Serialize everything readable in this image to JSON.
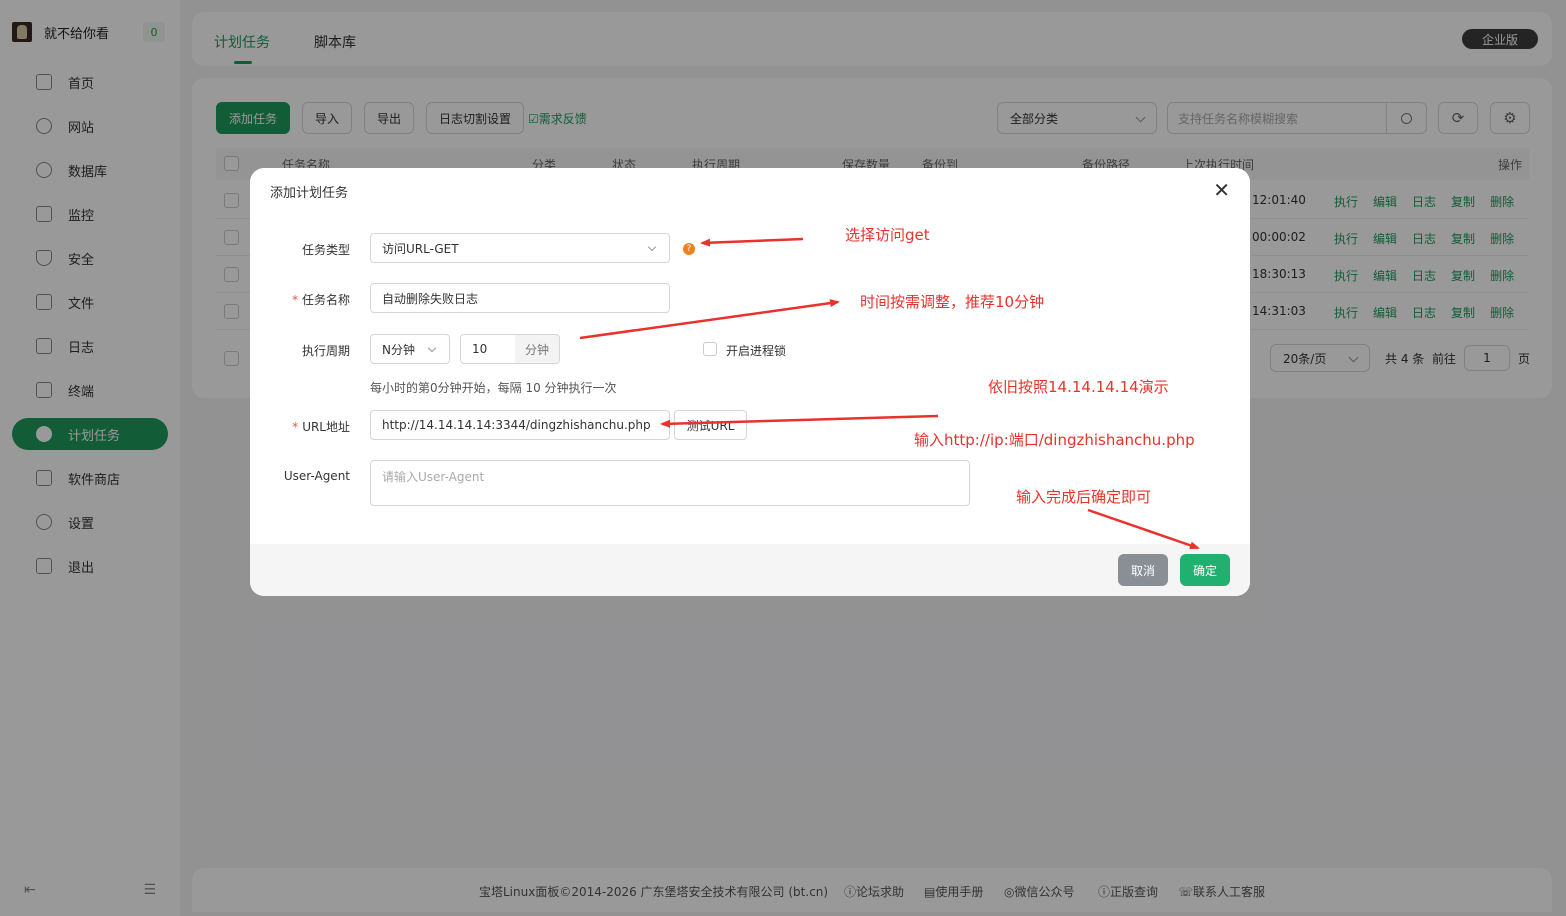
{
  "sidebar": {
    "username": "就不给你看",
    "badge": "0",
    "items": [
      {
        "label": "首页",
        "icon": "home-icon"
      },
      {
        "label": "网站",
        "icon": "globe-icon"
      },
      {
        "label": "数据库",
        "icon": "database-icon"
      },
      {
        "label": "监控",
        "icon": "monitor-icon"
      },
      {
        "label": "安全",
        "icon": "shield-icon"
      },
      {
        "label": "文件",
        "icon": "folder-icon"
      },
      {
        "label": "日志",
        "icon": "log-icon"
      },
      {
        "label": "终端",
        "icon": "terminal-icon"
      },
      {
        "label": "计划任务",
        "icon": "clock-icon"
      },
      {
        "label": "软件商店",
        "icon": "store-icon"
      },
      {
        "label": "设置",
        "icon": "gear-icon"
      },
      {
        "label": "退出",
        "icon": "logout-icon"
      }
    ],
    "active_index": 8
  },
  "tabs": {
    "cron": "计划任务",
    "scripts": "脚本库"
  },
  "edition": "企业版",
  "toolbar": {
    "add": "添加任务",
    "import": "导入",
    "export": "导出",
    "log_split": "日志切割设置",
    "feedback": "需求反馈",
    "category": "全部分类",
    "search_placeholder": "支持任务名称模糊搜索"
  },
  "table": {
    "headers": {
      "name": "任务名称",
      "category": "分类",
      "status": "状态",
      "period": "执行周期",
      "save_count": "保存数量",
      "backup_to": "备份到",
      "backup_path": "备份路径",
      "last_run": "上次执行时间",
      "ops": "操作"
    },
    "rows": [
      {
        "time": "12:01:40"
      },
      {
        "time": "00:00:02"
      },
      {
        "time": "18:30:13"
      },
      {
        "time": "14:31:03"
      }
    ],
    "ops": {
      "run": "执行",
      "edit": "编辑",
      "log": "日志",
      "copy": "复制",
      "del": "删除"
    }
  },
  "pager": {
    "per_page": "20条/页",
    "total": "共 4 条",
    "goto": "前往",
    "page": "1",
    "page_suffix": "页"
  },
  "dialog": {
    "title": "添加计划任务",
    "task_type_label": "任务类型",
    "task_type_value": "访问URL-GET",
    "task_name_label": "任务名称",
    "task_name_value": "自动删除失败日志",
    "period_label": "执行周期",
    "period_unit_select": "N分钟",
    "period_value": "10",
    "period_unit": "分钟",
    "lock_label": "开启进程锁",
    "hint": "每小时的第0分钟开始，每隔 10 分钟执行一次",
    "url_label": "URL地址",
    "url_value": "http://14.14.14.14:3344/dingzhishanchu.php",
    "test_url": "测试URL",
    "ua_label": "User-Agent",
    "ua_placeholder": "请输入User-Agent",
    "cancel": "取消",
    "ok": "确定"
  },
  "annotations": {
    "a1": "选择访问get",
    "a2": "时间按需调整，推荐10分钟",
    "a3": "依旧按照14.14.14.14演示",
    "a4": "输入http://ip:端口/dingzhishanchu.php",
    "a5": "输入完成后确定即可",
    "color": "#e8322c"
  },
  "footer": {
    "copyright": "宝塔Linux面板©2014-2026 广东堡塔安全技术有限公司 (bt.cn)",
    "forum": "论坛求助",
    "manual": "使用手册",
    "wechat": "微信公众号",
    "genuine": "正版查询",
    "support": "联系人工客服"
  },
  "colors": {
    "accent": "#1e9b5e",
    "danger": "#e8322c"
  }
}
